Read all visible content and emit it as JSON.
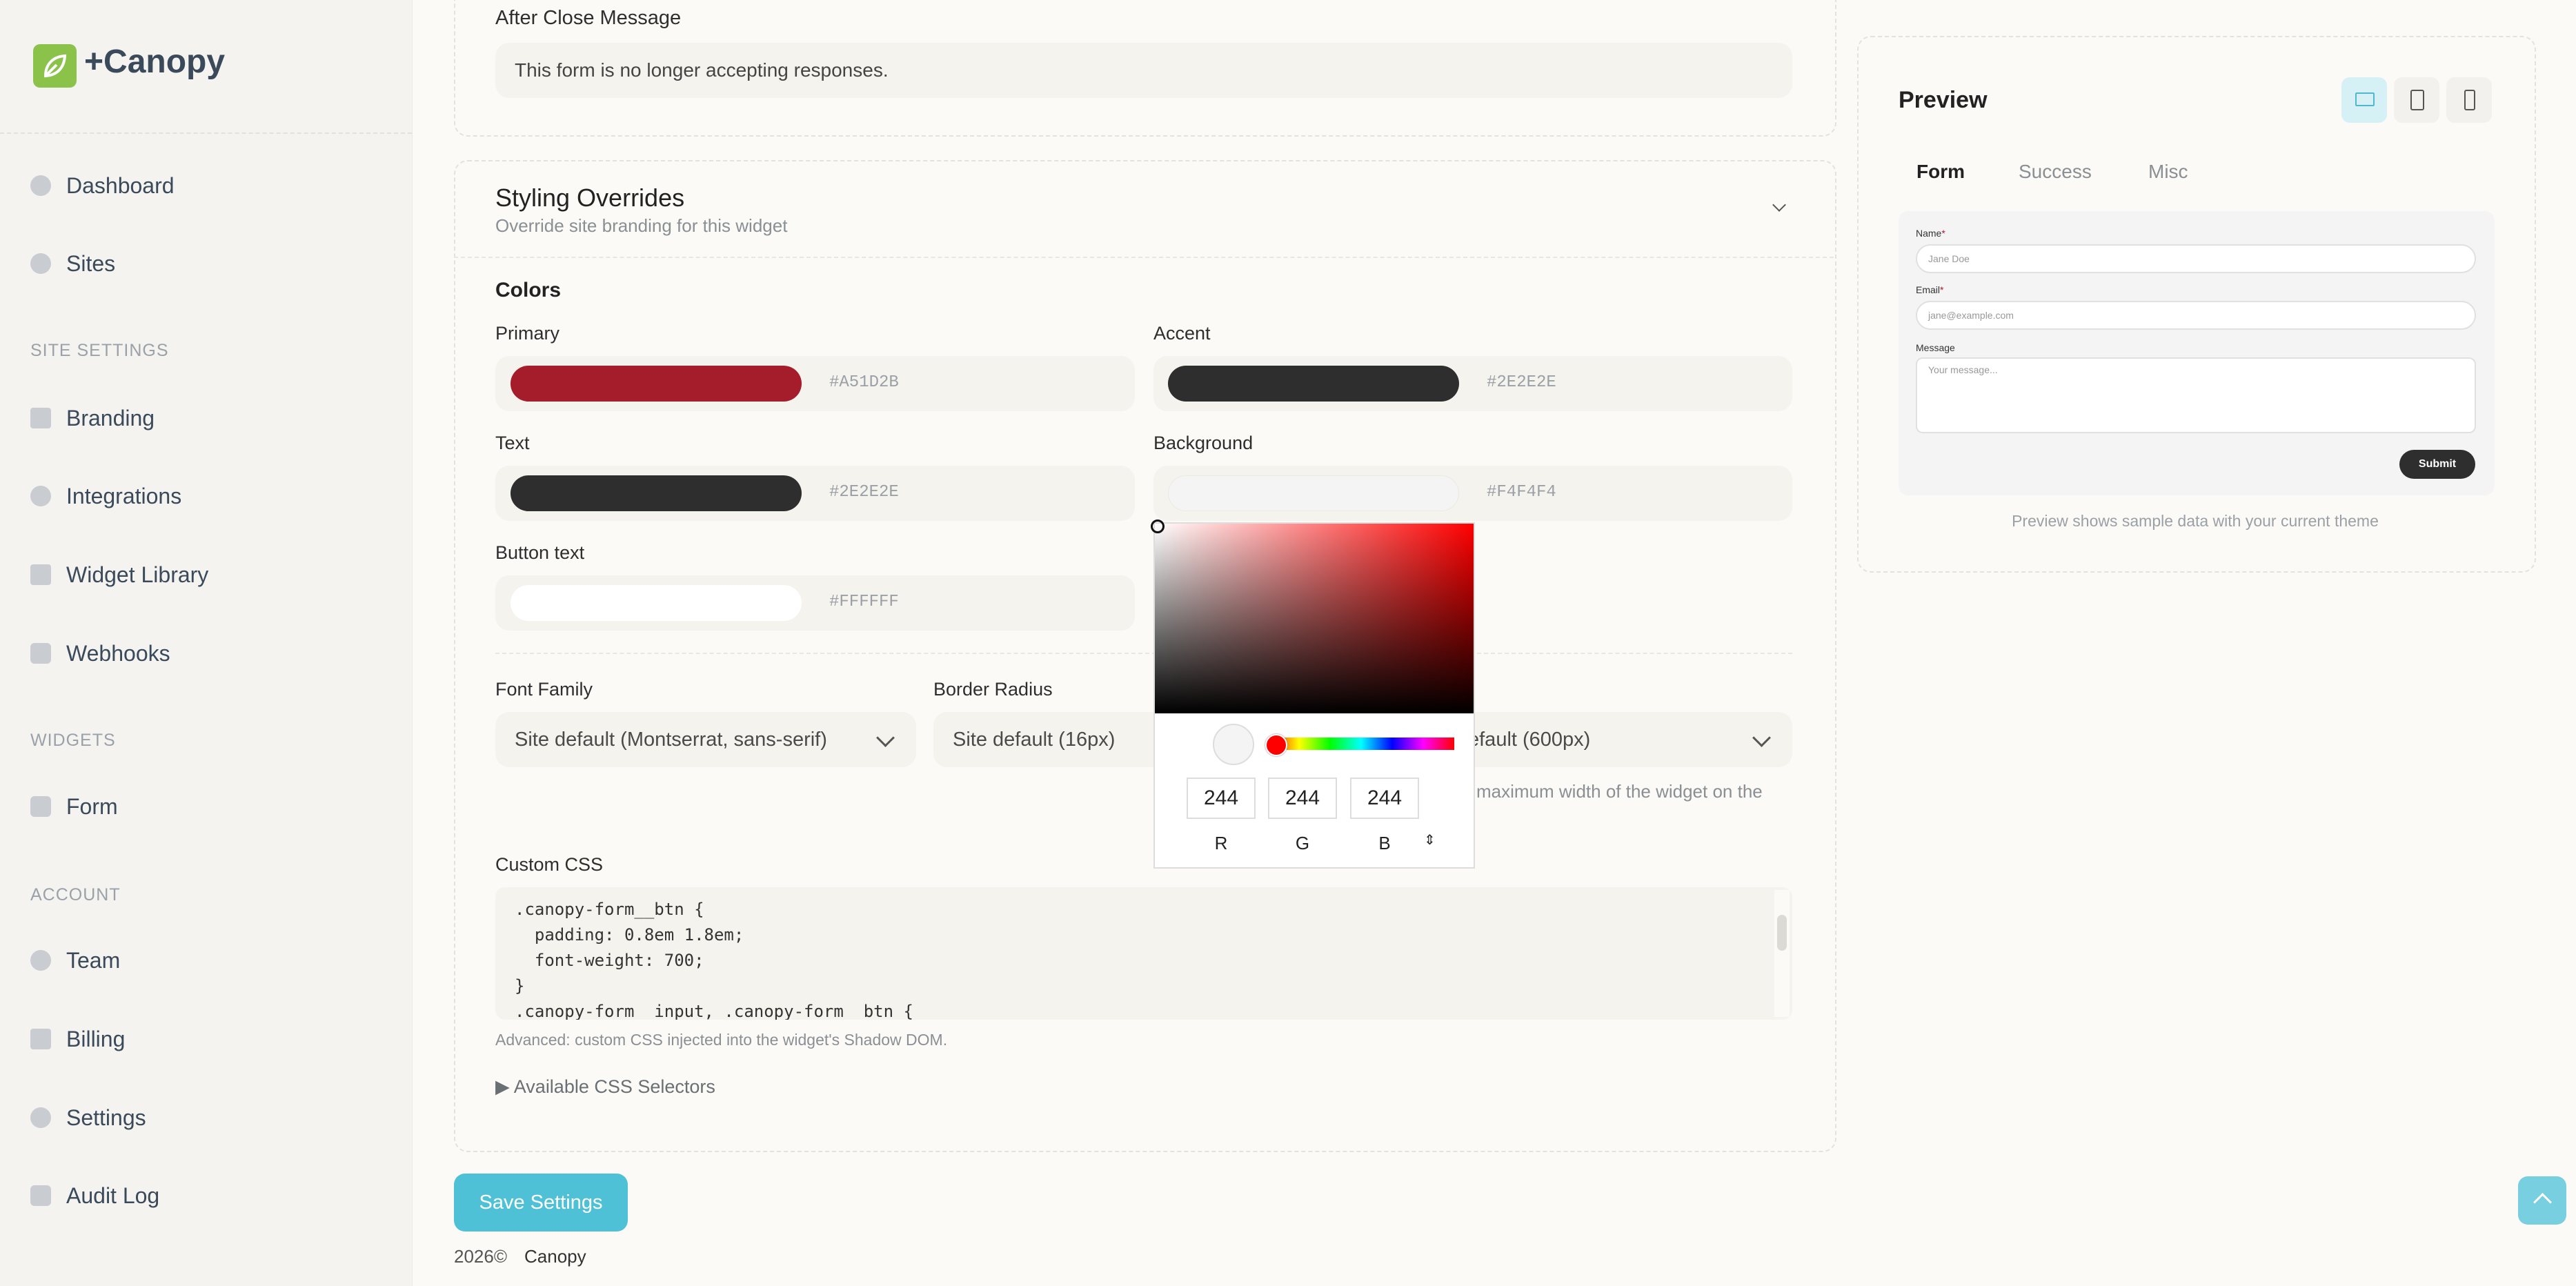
{
  "brand": {
    "name": "+Canopy"
  },
  "sidebar": {
    "dashboard": "Dashboard",
    "sites": "Sites",
    "section_site_settings": "SITE SETTINGS",
    "branding": "Branding",
    "integrations": "Integrations",
    "widget_library": "Widget Library",
    "webhooks": "Webhooks",
    "section_widgets": "WIDGETS",
    "form": "Form",
    "section_account": "ACCOUNT",
    "team": "Team",
    "billing": "Billing",
    "settings": "Settings",
    "audit_log": "Audit Log"
  },
  "after_close": {
    "label": "After Close Message",
    "value": "This form is no longer accepting responses."
  },
  "styling": {
    "title": "Styling Overrides",
    "subtitle": "Override site branding for this widget",
    "colors_heading": "Colors",
    "primary": {
      "label": "Primary",
      "hex": "#A51D2B",
      "color": "#a51d2b"
    },
    "accent": {
      "label": "Accent",
      "hex": "#2E2E2E",
      "color": "#2e2e2e"
    },
    "text": {
      "label": "Text",
      "hex": "#2E2E2E",
      "color": "#2e2e2e"
    },
    "background": {
      "label": "Background",
      "hex": "#F4F4F4",
      "color": "#f4f4f4"
    },
    "button_text": {
      "label": "Button text",
      "hex": "#FFFFFF",
      "color": "#ffffff"
    },
    "font_family": {
      "label": "Font Family",
      "value": "Site default (Montserrat, sans-serif)"
    },
    "border_radius": {
      "label": "Border Radius",
      "value": "Site default (16px)"
    },
    "max_width": {
      "value_partial": "efault (600px)",
      "help_partial": "maximum width of the widget on the"
    },
    "custom_css": {
      "label": "Custom CSS",
      "lines": [
        ".canopy-form__btn {",
        "  padding: 0.8em 1.8em;",
        "  font-weight: 700;",
        "}",
        ".canopy-form__input, .canopy-form__btn {"
      ],
      "help": "Advanced: custom CSS injected into the widget's Shadow DOM."
    },
    "selectors_toggle": "▶ Available CSS Selectors"
  },
  "picker": {
    "r": "244",
    "g": "244",
    "b": "244",
    "r_label": "R",
    "g_label": "G",
    "b_label": "B"
  },
  "save_label": "Save Settings",
  "footer": {
    "year": "2026©",
    "name": "Canopy"
  },
  "preview": {
    "title": "Preview",
    "tabs": [
      "Form",
      "Success",
      "Misc"
    ],
    "name_label": "Name",
    "name_placeholder": "Jane Doe",
    "email_label": "Email",
    "email_placeholder": "jane@example.com",
    "message_label": "Message",
    "message_placeholder": "Your message...",
    "required_mark": "*",
    "submit": "Submit",
    "note": "Preview shows sample data with your current theme"
  }
}
